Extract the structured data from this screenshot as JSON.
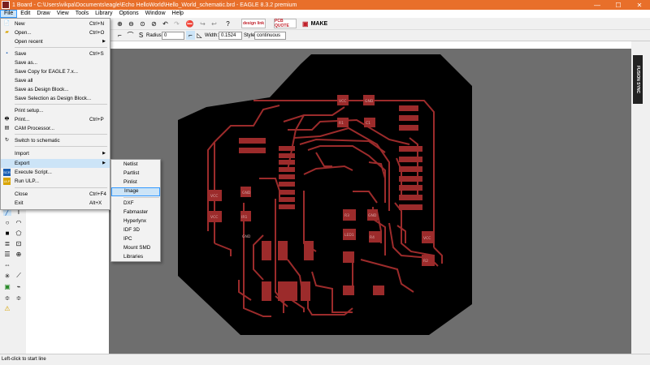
{
  "window": {
    "title": "1 Board - C:\\Users\\vikpa\\Documents\\eagle\\Echo HelloWorld\\Hello_World_schematic.brd - EAGLE 8.3.2 premium",
    "minimize": "—",
    "maximize": "☐",
    "close": "✕"
  },
  "menubar": [
    "File",
    "Edit",
    "Draw",
    "View",
    "Tools",
    "Library",
    "Options",
    "Window",
    "Help"
  ],
  "toolbar": {
    "design_link_label": "design link",
    "pcb_quote_label": "PCB QUOTE",
    "make_label": "MAKE"
  },
  "options_bar": {
    "radius_label": "Radius:",
    "radius_value": "0",
    "width_label": "Width:",
    "width_value": "0.1524",
    "style_label": "Style:",
    "style_value": "continuous"
  },
  "file_menu": [
    {
      "label": "New",
      "shortcut": "Ctrl+N",
      "icon": "new-file-icon"
    },
    {
      "label": "Open...",
      "shortcut": "Ctrl+O",
      "icon": "open-folder-icon"
    },
    {
      "label": "Open recent",
      "shortcut": "",
      "submenu": true
    },
    {
      "label": "Save",
      "shortcut": "Ctrl+S",
      "icon": "save-icon"
    },
    {
      "label": "Save as...",
      "shortcut": ""
    },
    {
      "label": "Save Copy for EAGLE 7.x...",
      "shortcut": ""
    },
    {
      "label": "Save all",
      "shortcut": ""
    },
    {
      "label": "Save as Design Block...",
      "shortcut": ""
    },
    {
      "label": "Save Selection as Design Block...",
      "shortcut": ""
    },
    {
      "label": "Print setup...",
      "shortcut": ""
    },
    {
      "label": "Print...",
      "shortcut": "Ctrl+P",
      "icon": "print-icon"
    },
    {
      "label": "CAM Processor...",
      "shortcut": "",
      "icon": "cam-icon"
    },
    {
      "label": "Switch to schematic",
      "shortcut": "",
      "icon": "schematic-icon"
    },
    {
      "label": "Import",
      "shortcut": "",
      "submenu": true
    },
    {
      "label": "Export",
      "shortcut": "",
      "submenu": true,
      "highlighted": true
    },
    {
      "label": "Execute Script...",
      "shortcut": "",
      "icon": "script-icon"
    },
    {
      "label": "Run ULP...",
      "shortcut": "",
      "icon": "ulp-icon"
    },
    {
      "label": "Close",
      "shortcut": "Ctrl+F4"
    },
    {
      "label": "Exit",
      "shortcut": "Alt+X"
    }
  ],
  "export_menu": [
    {
      "label": "Netlist"
    },
    {
      "label": "Partlist"
    },
    {
      "label": "Pinlist"
    },
    {
      "label": "Image",
      "highlighted": true
    },
    {
      "label": "DXF"
    },
    {
      "label": "Fabmaster"
    },
    {
      "label": "Hyperlynx"
    },
    {
      "label": "IDF 3D"
    },
    {
      "label": "IPC"
    },
    {
      "label": "Mount SMD"
    },
    {
      "label": "Libraries"
    }
  ],
  "board_labels": {
    "vcc1": "VCC",
    "gnd1": "GND",
    "r1": "R1",
    "c1": "C1",
    "vcc2": "VCC",
    "gnd2": "GND",
    "vcc3": "VCC",
    "ir1": "IR1",
    "vcc4": "VCC",
    "r3": "R3",
    "led1": "LED1",
    "r4": "R4",
    "gnd3": "GND",
    "r2": "R2",
    "gnd4": "GND",
    "gnd5": "GND"
  },
  "fusion_sync_label": "FUSION SYNC",
  "status_text": "Left-click to start line",
  "colors": {
    "titlebar": "#e86f2a",
    "board": "#000000",
    "copper": "#9c2b2b",
    "canvas_bg": "#6e6e6e",
    "menu_highlight": "#cce4f7"
  }
}
